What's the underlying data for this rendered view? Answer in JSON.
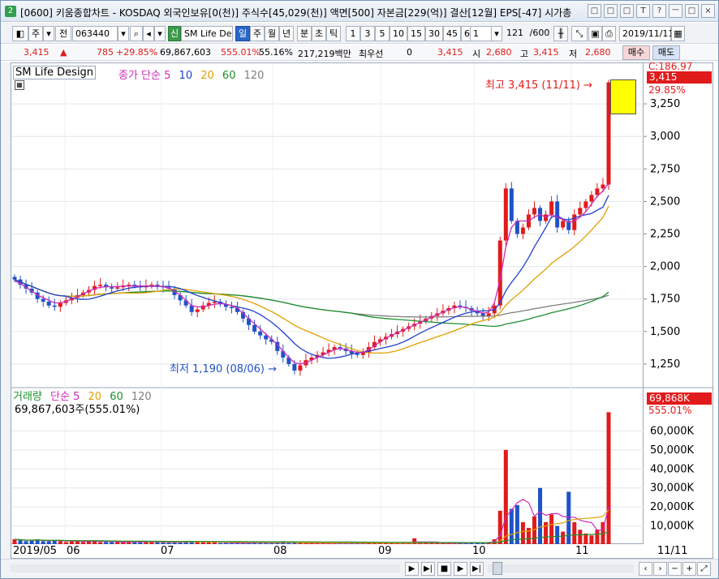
{
  "window": {
    "title": "[0600] 키움종합차트 - KOSDAQ 외국인보유[0(천)] 주식수[45,029(천)] 액면[500] 자본금[229(억)] 결산[12월] EPS[-47] 시가총",
    "icon_label": "2",
    "controls": [
      "□",
      "□",
      "□",
      "T",
      "?",
      "ㅡ",
      "□",
      "×"
    ]
  },
  "toolbar": {
    "type_button": "주",
    "prev_button": "전",
    "stock_code": "063440",
    "stock_name": "SM Life De",
    "new_badge": "신",
    "periods": [
      "일",
      "주",
      "월",
      "년",
      "분",
      "초",
      "틱"
    ],
    "selected_period": "일",
    "intervals": [
      "1",
      "3",
      "5",
      "10",
      "15",
      "30",
      "45",
      "60"
    ],
    "count_value": "1",
    "range": "121",
    "range_total": "/600",
    "date": "2019/11/11"
  },
  "quote": {
    "price": "3,415",
    "arrow": "▲",
    "change": "785",
    "change_pct": "+29.85%",
    "volume": "69,867,603",
    "vol_ratio": "555.01%",
    "turnover": "55.16%",
    "amount": "217,219백만",
    "priority_label": "최우선",
    "priority_value": "0",
    "current": "3,415",
    "open_label": "시",
    "open": "2,680",
    "high_label": "고",
    "high": "3,415",
    "low_label": "저",
    "low": "2,680",
    "buy_button": "매수",
    "sell_button": "매도"
  },
  "price_panel": {
    "stock_label": "SM Life Design",
    "indicator_label": "종가 단순",
    "ma_labels": [
      {
        "label": "5",
        "color": "#cc2ab8"
      },
      {
        "label": "10",
        "color": "#2040d0"
      },
      {
        "label": "20",
        "color": "#e0a000"
      },
      {
        "label": "60",
        "color": "#1f8f2f"
      },
      {
        "label": "120",
        "color": "#7f7f7f"
      }
    ],
    "high_annotation": "최고 3,415 (11/11) →",
    "low_annotation": "최저 1,190 (08/06) →",
    "y_labels": [
      "3,250",
      "3,000",
      "2,750",
      "2,500",
      "2,250",
      "2,000",
      "1,750",
      "1,500",
      "1,250"
    ],
    "top_tags": [
      "C:186.97",
      "3,415",
      "29.85%"
    ]
  },
  "volume_panel": {
    "label": "거래량",
    "indicator_label": "단순",
    "ma_labels": [
      {
        "label": "5",
        "color": "#cc2ab8"
      },
      {
        "label": "20",
        "color": "#e0a000"
      },
      {
        "label": "60",
        "color": "#1f8f2f"
      },
      {
        "label": "120",
        "color": "#7f7f7f"
      }
    ],
    "value_text": "69,867,603주(555.01%)",
    "y_labels": [
      "60,000K",
      "50,000K",
      "40,000K",
      "30,000K",
      "20,000K",
      "10,000K"
    ],
    "top_tags": [
      "69,868K",
      "555.01%"
    ]
  },
  "x_axis": {
    "labels": [
      "2019/05",
      "06",
      "07",
      "08",
      "09",
      "10",
      "11"
    ],
    "right_label": "11/11"
  },
  "colors": {
    "up": "#e11b1b",
    "down": "#1f52c8",
    "ma5": "#cc2ab8",
    "ma10": "#2040d0",
    "ma20": "#e0a000",
    "ma60": "#1f8f2f",
    "ma120": "#7f7f7f"
  },
  "chart_data": {
    "type": "candlestick",
    "price_range": [
      1100,
      3500
    ],
    "volume_range": [
      0,
      70000
    ],
    "volume_unit": "K",
    "high_price": 3415,
    "low_price": 1190,
    "key_points": [
      {
        "date": "08/06",
        "price": 1190,
        "label": "최저"
      },
      {
        "date": "11/11",
        "price": 3415,
        "label": "최고"
      }
    ],
    "closes": [
      1900,
      1860,
      1830,
      1800,
      1750,
      1730,
      1700,
      1690,
      1720,
      1740,
      1760,
      1780,
      1800,
      1820,
      1850,
      1860,
      1840,
      1830,
      1840,
      1850,
      1860,
      1850,
      1840,
      1850,
      1860,
      1850,
      1840,
      1830,
      1780,
      1740,
      1700,
      1650,
      1670,
      1700,
      1720,
      1730,
      1710,
      1690,
      1680,
      1650,
      1600,
      1550,
      1500,
      1470,
      1440,
      1420,
      1350,
      1300,
      1250,
      1200,
      1240,
      1280,
      1300,
      1320,
      1340,
      1360,
      1380,
      1370,
      1350,
      1330,
      1320,
      1340,
      1380,
      1420,
      1440,
      1460,
      1480,
      1500,
      1520,
      1540,
      1560,
      1580,
      1600,
      1620,
      1640,
      1660,
      1680,
      1700,
      1690,
      1680,
      1660,
      1640,
      1620,
      1640,
      1700,
      2200,
      2600,
      2350,
      2250,
      2300,
      2400,
      2450,
      2350,
      2400,
      2500,
      2300,
      2350,
      2280,
      2400,
      2450,
      2500,
      2550,
      2600,
      2630,
      3415
    ],
    "volumes": [
      3000,
      2500,
      2000,
      2500,
      3000,
      2000,
      2000,
      2500,
      2000,
      1500,
      2000,
      2000,
      1500,
      2000,
      2500,
      1500,
      1500,
      1500,
      1500,
      1500,
      1500,
      2000,
      1500,
      1500,
      1500,
      1500,
      1500,
      1200,
      1500,
      1500,
      2000,
      2000,
      1500,
      1500,
      1500,
      1500,
      1000,
      1000,
      1000,
      1000,
      1200,
      1200,
      1500,
      1000,
      1000,
      1000,
      1500,
      2000,
      1000,
      1200,
      1200,
      1000,
      1000,
      1000,
      1000,
      800,
      800,
      800,
      1000,
      1000,
      1000,
      1200,
      1500,
      1200,
      1200,
      1000,
      1000,
      1000,
      1000,
      1200,
      3500,
      1000,
      1000,
      1000,
      1000,
      1000,
      1000,
      1000,
      1000,
      1200,
      1500,
      1500,
      1000,
      1200,
      3000,
      18000,
      50000,
      19000,
      21000,
      12000,
      9000,
      15000,
      30000,
      12000,
      16000,
      10000,
      7000,
      28000,
      12000,
      8000,
      6000,
      5000,
      8000,
      12000,
      69868
    ],
    "ma5": [
      1890,
      1870,
      1840,
      1810,
      1780,
      1760,
      1740,
      1720,
      1720,
      1730,
      1750,
      1770,
      1790,
      1810,
      1830,
      1840,
      1845,
      1845,
      1845,
      1850,
      1850,
      1850,
      1850,
      1850,
      1850,
      1850,
      1845,
      1835,
      1810,
      1780,
      1740,
      1700,
      1690,
      1690,
      1700,
      1710,
      1715,
      1710,
      1700,
      1680,
      1640,
      1600,
      1560,
      1520,
      1480,
      1440,
      1400,
      1350,
      1300,
      1260,
      1250,
      1260,
      1280,
      1300,
      1320,
      1340,
      1360,
      1370,
      1360,
      1350,
      1340,
      1340,
      1360,
      1390,
      1420,
      1450,
      1470,
      1490,
      1510,
      1530,
      1550,
      1570,
      1590,
      1610,
      1630,
      1650,
      1670,
      1685,
      1690,
      1685,
      1670,
      1655,
      1640,
      1650,
      1720,
      1900,
      2150,
      2300,
      2350,
      2350,
      2350,
      2380,
      2400,
      2380,
      2400,
      2380,
      2360,
      2340,
      2350,
      2380,
      2420,
      2480,
      2540,
      2580,
      2640
    ]
  }
}
